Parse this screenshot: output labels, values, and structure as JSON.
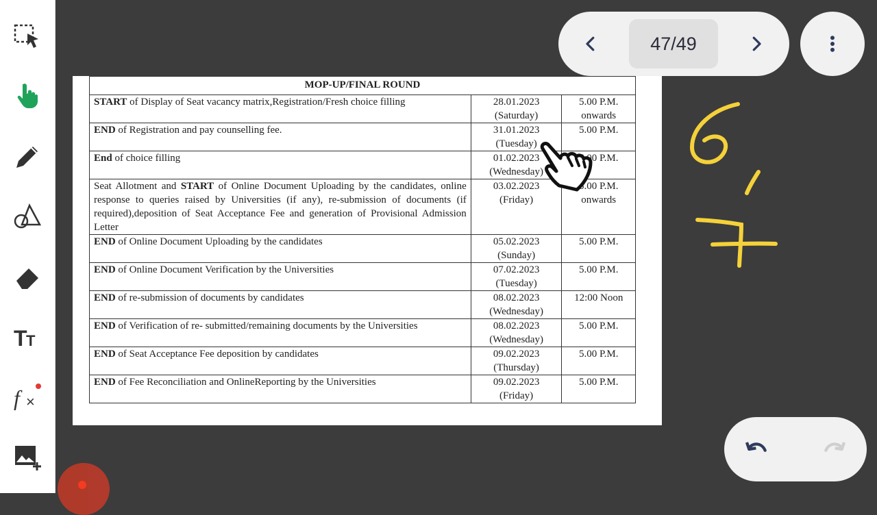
{
  "toolbar": {
    "tools": [
      {
        "name": "select-icon"
      },
      {
        "name": "pointer-hand-icon"
      },
      {
        "name": "pen-icon"
      },
      {
        "name": "shapes-icon"
      },
      {
        "name": "eraser-icon"
      },
      {
        "name": "text-size-icon"
      },
      {
        "name": "formula-icon"
      },
      {
        "name": "add-image-icon"
      }
    ],
    "active_color": "#1fa35b"
  },
  "pager": {
    "page_label": "47/49"
  },
  "document": {
    "title": "MOP-UP/FINAL ROUND",
    "rows": [
      {
        "kw": "START",
        "rest": " of Display of Seat vacancy matrix,Registration/Fresh choice filling",
        "date": "28.01.2023",
        "day": "(Saturday)",
        "time": "5.00 P.M.",
        "time2": "onwards"
      },
      {
        "kw": "END",
        "rest": " of  Registration   and pay counselling fee.",
        "date": "31.01.2023",
        "day": "(Tuesday)",
        "time": "5.00 P.M.",
        "time2": ""
      },
      {
        "kw": "End",
        "rest": " of choice filling",
        "date": "01.02.2023",
        "day": "(Wednesday)",
        "time": "5.00 P.M.",
        "time2": ""
      },
      {
        "pre": "Seat Allotment and ",
        "kw": "START",
        "rest": " of Online Document Uploading by the candidates, online response to queries raised by Universities (if any), re-submission of documents (if required),deposition of Seat Acceptance Fee and generation of Provisional Admission Letter",
        "date": "03.02.2023",
        "day": "(Friday)",
        "time": "5.00 P.M.",
        "time2": "onwards"
      },
      {
        "kw": "END",
        "rest": " of Online Document Uploading by the candidates",
        "date": "05.02.2023",
        "day": "(Sunday)",
        "time": "5.00 P.M.",
        "time2": ""
      },
      {
        "kw": "END",
        "rest": " of Online Document Verification by the Universities",
        "date": "07.02.2023",
        "day": "(Tuesday)",
        "time": "5.00 P.M.",
        "time2": ""
      },
      {
        "kw": "END",
        "rest": " of  re-submission  of documents  by candidates",
        "date": "08.02.2023",
        "day": "(Wednesday)",
        "time": "12:00 Noon",
        "time2": ""
      },
      {
        "kw": "END",
        "rest": " of Verification of re- submitted/remaining documents by the Universities",
        "date": "08.02.2023",
        "day": "(Wednesday)",
        "time": "5.00 P.M.",
        "time2": ""
      },
      {
        "kw": "END",
        "rest": " of Seat Acceptance Fee deposition by candidates",
        "date": "09.02.2023",
        "day": "(Thursday)",
        "time": "5.00 P.M.",
        "time2": ""
      },
      {
        "kw": "END",
        "rest": " of Fee Reconciliation and OnlineReporting by the Universities",
        "date": "09.02.2023",
        "day": "(Friday)",
        "time": "5.00 P.M.",
        "time2": ""
      }
    ]
  },
  "annotations": {
    "ink_color": "#f5d13a",
    "handwriting": "6, 7"
  },
  "colors": {
    "background": "#3c3c3c",
    "pill": "#f1f1f1",
    "record": "#b63a2a"
  }
}
